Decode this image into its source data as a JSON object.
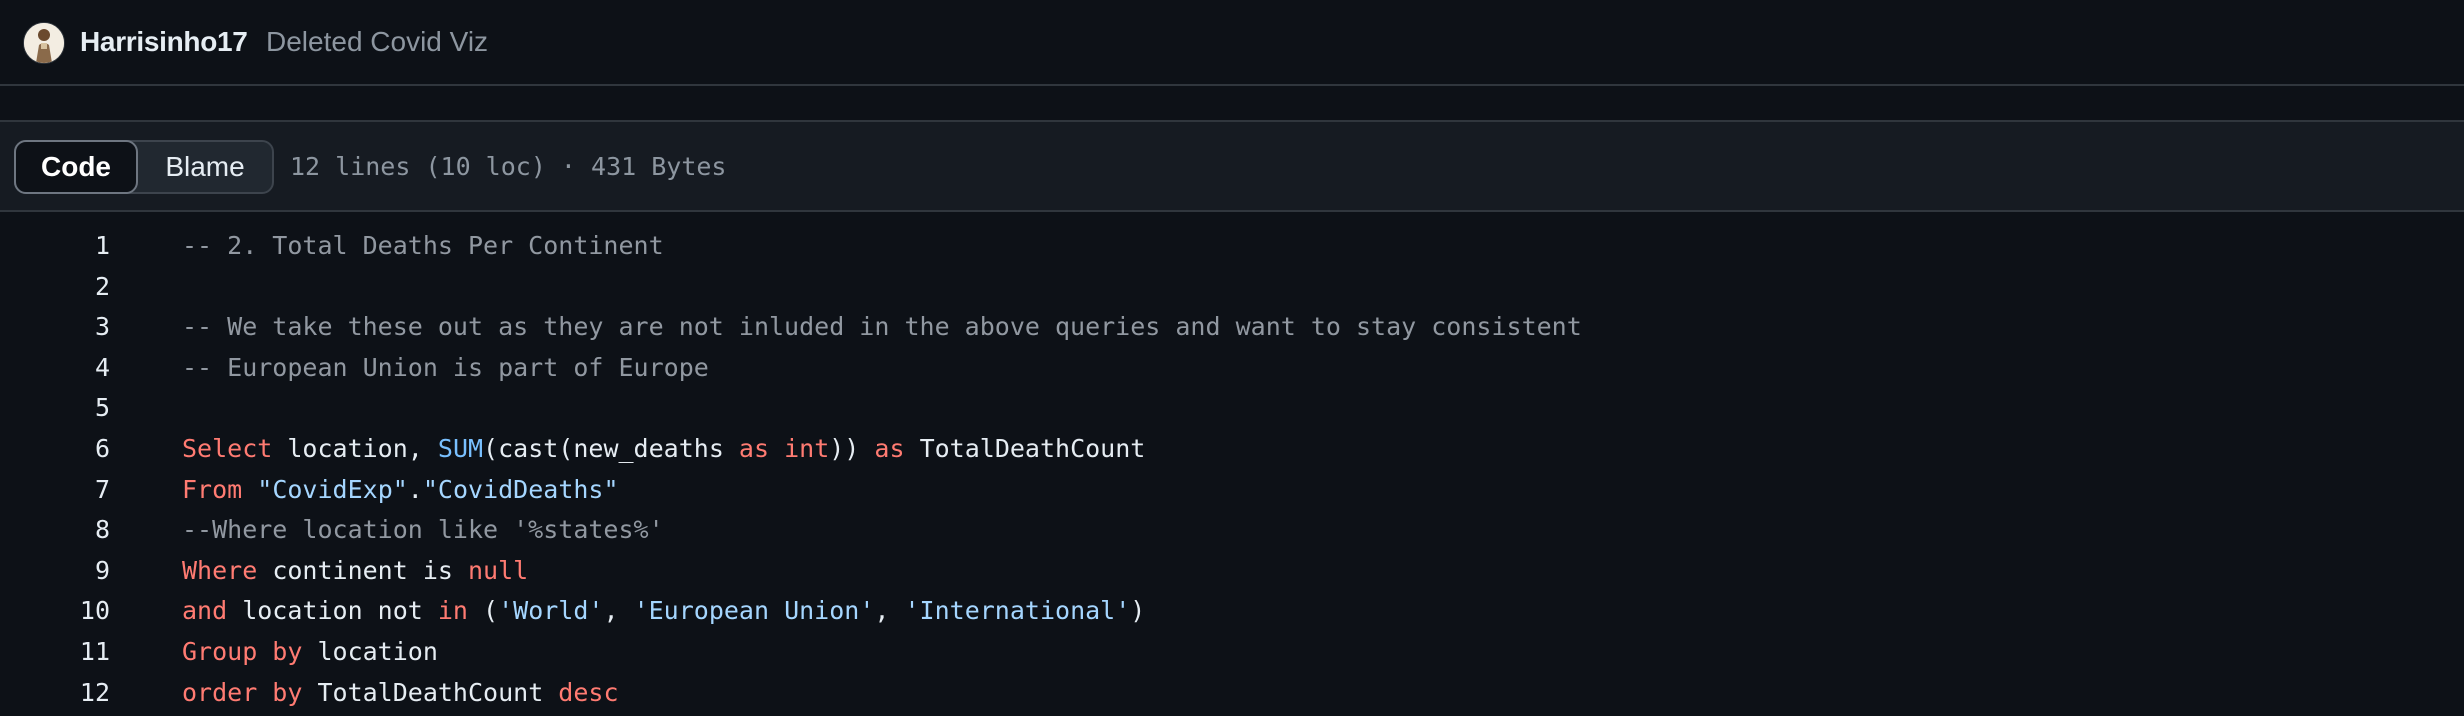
{
  "commit": {
    "author": "Harrisinho17",
    "message": "Deleted Covid Viz"
  },
  "toolbar": {
    "code_tab": "Code",
    "blame_tab": "Blame",
    "file_info": "12 lines (10 loc) · 431 Bytes"
  },
  "code_lines": [
    {
      "n": "1",
      "tokens": [
        {
          "t": "-- 2. Total Deaths Per Continent",
          "c": "comment"
        }
      ]
    },
    {
      "n": "2",
      "tokens": []
    },
    {
      "n": "3",
      "tokens": [
        {
          "t": "-- We take these out as they are not inluded in the above queries and want to stay consistent",
          "c": "comment"
        }
      ]
    },
    {
      "n": "4",
      "tokens": [
        {
          "t": "-- European Union is part of Europe",
          "c": "comment"
        }
      ]
    },
    {
      "n": "5",
      "tokens": []
    },
    {
      "n": "6",
      "tokens": [
        {
          "t": "Select",
          "c": "keyword"
        },
        {
          "t": " location, ",
          "c": "plain"
        },
        {
          "t": "SUM",
          "c": "func"
        },
        {
          "t": "(cast(new_deaths ",
          "c": "plain"
        },
        {
          "t": "as",
          "c": "keyword"
        },
        {
          "t": " ",
          "c": "plain"
        },
        {
          "t": "int",
          "c": "keyword"
        },
        {
          "t": ")) ",
          "c": "plain"
        },
        {
          "t": "as",
          "c": "keyword"
        },
        {
          "t": " TotalDeathCount",
          "c": "plain"
        }
      ]
    },
    {
      "n": "7",
      "tokens": [
        {
          "t": "From",
          "c": "keyword"
        },
        {
          "t": " ",
          "c": "plain"
        },
        {
          "t": "\"CovidExp\"",
          "c": "string"
        },
        {
          "t": ".",
          "c": "plain"
        },
        {
          "t": "\"CovidDeaths\"",
          "c": "string"
        }
      ]
    },
    {
      "n": "8",
      "tokens": [
        {
          "t": "--Where location like '%states%'",
          "c": "comment"
        }
      ]
    },
    {
      "n": "9",
      "tokens": [
        {
          "t": "Where",
          "c": "keyword"
        },
        {
          "t": " continent is ",
          "c": "plain"
        },
        {
          "t": "null",
          "c": "keyword"
        }
      ]
    },
    {
      "n": "10",
      "tokens": [
        {
          "t": "and",
          "c": "keyword"
        },
        {
          "t": " location not ",
          "c": "plain"
        },
        {
          "t": "in",
          "c": "keyword"
        },
        {
          "t": " (",
          "c": "plain"
        },
        {
          "t": "'World'",
          "c": "string"
        },
        {
          "t": ", ",
          "c": "plain"
        },
        {
          "t": "'European Union'",
          "c": "string"
        },
        {
          "t": ", ",
          "c": "plain"
        },
        {
          "t": "'International'",
          "c": "string"
        },
        {
          "t": ")",
          "c": "plain"
        }
      ]
    },
    {
      "n": "11",
      "tokens": [
        {
          "t": "Group by",
          "c": "keyword"
        },
        {
          "t": " location",
          "c": "plain"
        }
      ]
    },
    {
      "n": "12",
      "tokens": [
        {
          "t": "order by",
          "c": "keyword"
        },
        {
          "t": " TotalDeathCount ",
          "c": "plain"
        },
        {
          "t": "desc",
          "c": "keyword"
        }
      ]
    }
  ],
  "colors": {
    "background": "#0d1117",
    "keyword": "#ff7b72",
    "function": "#79c0ff",
    "string": "#a5d6ff",
    "comment": "#9198a1"
  }
}
